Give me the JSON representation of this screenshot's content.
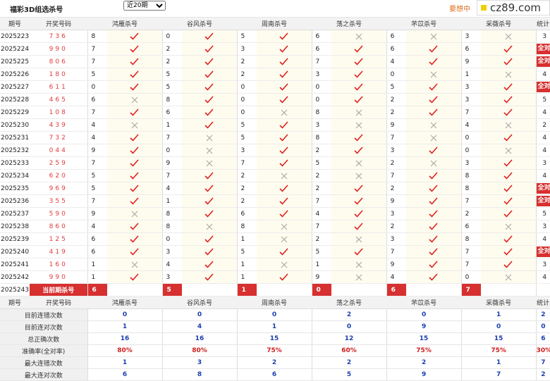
{
  "header": {
    "title": "福彩3D组选杀号",
    "period_options": [
      "近20期"
    ],
    "period_selected": "近20期",
    "promo": "要想中",
    "watermark": "cz89.com"
  },
  "columns": [
    "期号",
    "开奖号码",
    "鸿雁杀号",
    "谷风杀号",
    "周南杀号",
    "荡之杀号",
    "芣苡杀号",
    "采薇杀号",
    "统计"
  ],
  "rows": [
    {
      "period": "2025223",
      "draw": "736",
      "cells": [
        {
          "n": "8",
          "ok": true
        },
        {
          "n": "0",
          "ok": true
        },
        {
          "n": "5",
          "ok": true
        },
        {
          "n": "6",
          "ok": false
        },
        {
          "n": "6",
          "ok": false
        },
        {
          "n": "3",
          "ok": false
        }
      ],
      "stat": "3",
      "full": false
    },
    {
      "period": "2025224",
      "draw": "990",
      "cells": [
        {
          "n": "7",
          "ok": true
        },
        {
          "n": "2",
          "ok": true
        },
        {
          "n": "3",
          "ok": true
        },
        {
          "n": "6",
          "ok": true
        },
        {
          "n": "6",
          "ok": true
        },
        {
          "n": "6",
          "ok": true
        }
      ],
      "stat": "全对",
      "full": true
    },
    {
      "period": "2025225",
      "draw": "806",
      "cells": [
        {
          "n": "7",
          "ok": true
        },
        {
          "n": "2",
          "ok": true
        },
        {
          "n": "2",
          "ok": true
        },
        {
          "n": "7",
          "ok": true
        },
        {
          "n": "4",
          "ok": true
        },
        {
          "n": "9",
          "ok": true
        }
      ],
      "stat": "全对",
      "full": true
    },
    {
      "period": "2025226",
      "draw": "180",
      "cells": [
        {
          "n": "5",
          "ok": true
        },
        {
          "n": "5",
          "ok": true
        },
        {
          "n": "2",
          "ok": true
        },
        {
          "n": "3",
          "ok": true
        },
        {
          "n": "0",
          "ok": false
        },
        {
          "n": "1",
          "ok": false
        }
      ],
      "stat": "4",
      "full": false
    },
    {
      "period": "2025227",
      "draw": "611",
      "cells": [
        {
          "n": "0",
          "ok": true
        },
        {
          "n": "5",
          "ok": true
        },
        {
          "n": "0",
          "ok": true
        },
        {
          "n": "0",
          "ok": true
        },
        {
          "n": "5",
          "ok": true
        },
        {
          "n": "3",
          "ok": true
        }
      ],
      "stat": "全对",
      "full": true
    },
    {
      "period": "2025228",
      "draw": "465",
      "cells": [
        {
          "n": "6",
          "ok": false
        },
        {
          "n": "8",
          "ok": true
        },
        {
          "n": "0",
          "ok": true
        },
        {
          "n": "0",
          "ok": true
        },
        {
          "n": "2",
          "ok": true
        },
        {
          "n": "3",
          "ok": true
        }
      ],
      "stat": "5",
      "full": false
    },
    {
      "period": "2025229",
      "draw": "108",
      "cells": [
        {
          "n": "7",
          "ok": true
        },
        {
          "n": "6",
          "ok": true
        },
        {
          "n": "0",
          "ok": false
        },
        {
          "n": "8",
          "ok": false
        },
        {
          "n": "2",
          "ok": true
        },
        {
          "n": "7",
          "ok": true
        }
      ],
      "stat": "4",
      "full": false
    },
    {
      "period": "2025230",
      "draw": "439",
      "cells": [
        {
          "n": "4",
          "ok": false
        },
        {
          "n": "1",
          "ok": true
        },
        {
          "n": "5",
          "ok": true
        },
        {
          "n": "3",
          "ok": false
        },
        {
          "n": "9",
          "ok": false
        },
        {
          "n": "4",
          "ok": false
        }
      ],
      "stat": "2",
      "full": false
    },
    {
      "period": "2025231",
      "draw": "732",
      "cells": [
        {
          "n": "4",
          "ok": true
        },
        {
          "n": "7",
          "ok": false
        },
        {
          "n": "5",
          "ok": true
        },
        {
          "n": "8",
          "ok": true
        },
        {
          "n": "7",
          "ok": false
        },
        {
          "n": "0",
          "ok": true
        }
      ],
      "stat": "4",
      "full": false
    },
    {
      "period": "2025232",
      "draw": "044",
      "cells": [
        {
          "n": "9",
          "ok": true
        },
        {
          "n": "0",
          "ok": false
        },
        {
          "n": "3",
          "ok": true
        },
        {
          "n": "2",
          "ok": true
        },
        {
          "n": "3",
          "ok": true
        },
        {
          "n": "0",
          "ok": false
        }
      ],
      "stat": "4",
      "full": false
    },
    {
      "period": "2025233",
      "draw": "259",
      "cells": [
        {
          "n": "7",
          "ok": true
        },
        {
          "n": "9",
          "ok": false
        },
        {
          "n": "7",
          "ok": true
        },
        {
          "n": "5",
          "ok": false
        },
        {
          "n": "2",
          "ok": false
        },
        {
          "n": "3",
          "ok": true
        }
      ],
      "stat": "3",
      "full": false
    },
    {
      "period": "2025234",
      "draw": "620",
      "cells": [
        {
          "n": "5",
          "ok": true
        },
        {
          "n": "7",
          "ok": true
        },
        {
          "n": "2",
          "ok": false
        },
        {
          "n": "2",
          "ok": false
        },
        {
          "n": "7",
          "ok": true
        },
        {
          "n": "8",
          "ok": true
        }
      ],
      "stat": "4",
      "full": false
    },
    {
      "period": "2025235",
      "draw": "969",
      "cells": [
        {
          "n": "5",
          "ok": true
        },
        {
          "n": "4",
          "ok": true
        },
        {
          "n": "2",
          "ok": true
        },
        {
          "n": "2",
          "ok": true
        },
        {
          "n": "2",
          "ok": true
        },
        {
          "n": "8",
          "ok": true
        }
      ],
      "stat": "全对",
      "full": true
    },
    {
      "period": "2025236",
      "draw": "355",
      "cells": [
        {
          "n": "7",
          "ok": true
        },
        {
          "n": "1",
          "ok": true
        },
        {
          "n": "2",
          "ok": true
        },
        {
          "n": "7",
          "ok": true
        },
        {
          "n": "9",
          "ok": true
        },
        {
          "n": "7",
          "ok": true
        }
      ],
      "stat": "全对",
      "full": true
    },
    {
      "period": "2025237",
      "draw": "590",
      "cells": [
        {
          "n": "9",
          "ok": false
        },
        {
          "n": "8",
          "ok": true
        },
        {
          "n": "6",
          "ok": true
        },
        {
          "n": "4",
          "ok": true
        },
        {
          "n": "3",
          "ok": true
        },
        {
          "n": "2",
          "ok": true
        }
      ],
      "stat": "5",
      "full": false
    },
    {
      "period": "2025238",
      "draw": "860",
      "cells": [
        {
          "n": "4",
          "ok": true
        },
        {
          "n": "8",
          "ok": false
        },
        {
          "n": "8",
          "ok": false
        },
        {
          "n": "7",
          "ok": true
        },
        {
          "n": "2",
          "ok": true
        },
        {
          "n": "6",
          "ok": false
        }
      ],
      "stat": "3",
      "full": false
    },
    {
      "period": "2025239",
      "draw": "125",
      "cells": [
        {
          "n": "6",
          "ok": true
        },
        {
          "n": "0",
          "ok": true
        },
        {
          "n": "1",
          "ok": false
        },
        {
          "n": "2",
          "ok": false
        },
        {
          "n": "3",
          "ok": true
        },
        {
          "n": "8",
          "ok": true
        }
      ],
      "stat": "4",
      "full": false
    },
    {
      "period": "2025240",
      "draw": "419",
      "cells": [
        {
          "n": "6",
          "ok": true
        },
        {
          "n": "3",
          "ok": true
        },
        {
          "n": "5",
          "ok": true
        },
        {
          "n": "5",
          "ok": true
        },
        {
          "n": "7",
          "ok": true
        },
        {
          "n": "7",
          "ok": true
        }
      ],
      "stat": "全对",
      "full": true
    },
    {
      "period": "2025241",
      "draw": "160",
      "cells": [
        {
          "n": "1",
          "ok": false
        },
        {
          "n": "4",
          "ok": true
        },
        {
          "n": "1",
          "ok": false
        },
        {
          "n": "1",
          "ok": false
        },
        {
          "n": "9",
          "ok": true
        },
        {
          "n": "7",
          "ok": true
        }
      ],
      "stat": "3",
      "full": false
    },
    {
      "period": "2025242",
      "draw": "990",
      "cells": [
        {
          "n": "1",
          "ok": true
        },
        {
          "n": "3",
          "ok": true
        },
        {
          "n": "1",
          "ok": true
        },
        {
          "n": "9",
          "ok": false
        },
        {
          "n": "4",
          "ok": true
        },
        {
          "n": "0",
          "ok": false
        }
      ],
      "stat": "4",
      "full": false
    }
  ],
  "current": {
    "period": "2025243",
    "label": "当前期杀号",
    "values": [
      "6",
      "5",
      "1",
      "0",
      "6",
      "7"
    ]
  },
  "summary": [
    {
      "label": "目前连错次数",
      "values": [
        "0",
        "0",
        "0",
        "2",
        "0",
        "1"
      ],
      "stat": "2",
      "red": false
    },
    {
      "label": "目前连对次数",
      "values": [
        "1",
        "4",
        "1",
        "0",
        "9",
        "0"
      ],
      "stat": "0",
      "red": false
    },
    {
      "label": "总正确次数",
      "values": [
        "16",
        "16",
        "15",
        "12",
        "15",
        "15"
      ],
      "stat": "6",
      "red": false
    },
    {
      "label": "准确率(全对率)",
      "values": [
        "80%",
        "80%",
        "75%",
        "60%",
        "75%",
        "75%"
      ],
      "stat": "30%",
      "red": true
    },
    {
      "label": "最大连错次数",
      "values": [
        "1",
        "3",
        "2",
        "2",
        "2",
        "1"
      ],
      "stat": "7",
      "red": false
    },
    {
      "label": "最大连对次数",
      "values": [
        "6",
        "8",
        "6",
        "5",
        "9",
        "7"
      ],
      "stat": "2",
      "red": false
    }
  ],
  "colors": {
    "accent_red": "#d73030",
    "draw_red": "#e23b3b",
    "check_red": "#e02020",
    "cross_gray": "#aaaaaa",
    "summary_blue": "#1a3fb0",
    "highlight_bg": "#fefcee"
  },
  "icons": {
    "ok": "check-icon",
    "fail": "cross-icon"
  }
}
